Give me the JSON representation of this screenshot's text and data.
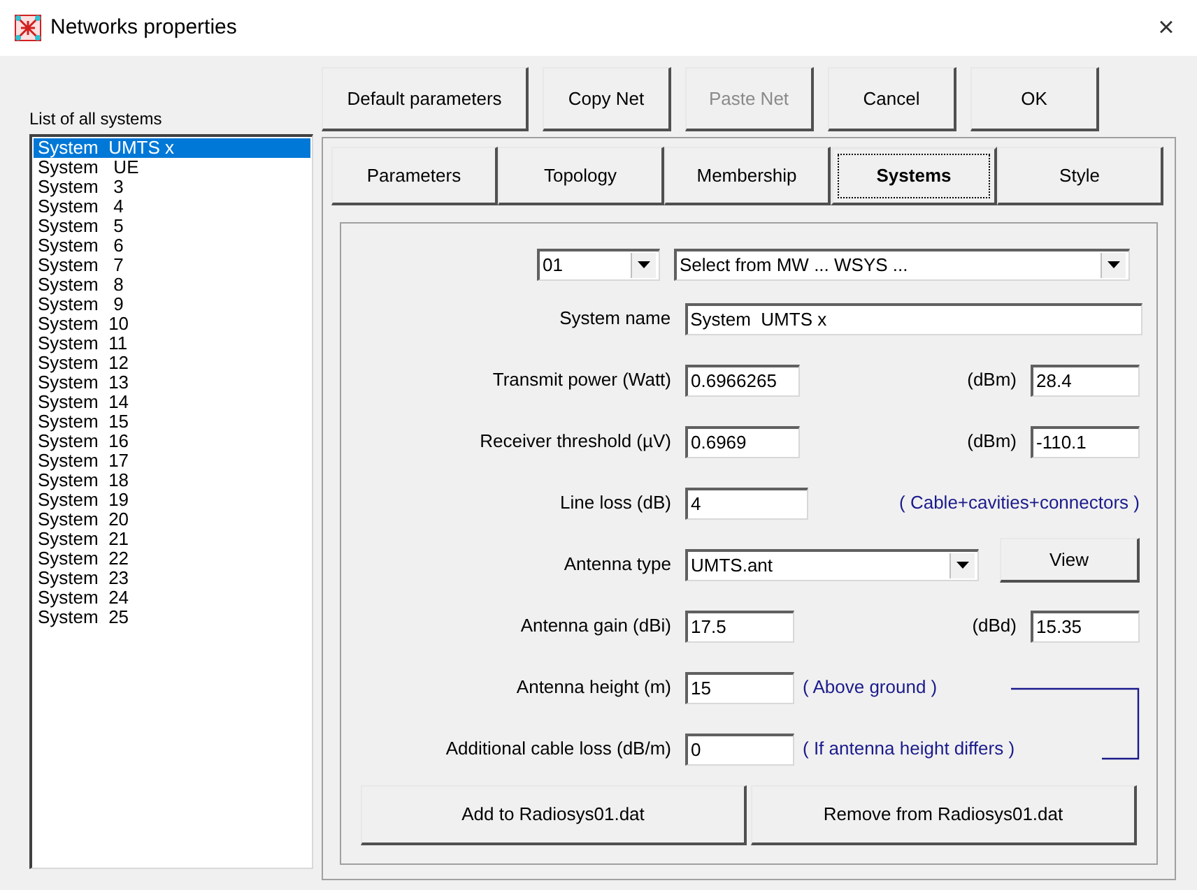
{
  "window": {
    "title": "Networks properties",
    "close": "×"
  },
  "list_label": "List of all systems",
  "systems": [
    {
      "label": "System  UMTS x",
      "selected": true
    },
    {
      "label": "System   UE",
      "selected": false
    },
    {
      "label": "System   3",
      "selected": false
    },
    {
      "label": "System   4",
      "selected": false
    },
    {
      "label": "System   5",
      "selected": false
    },
    {
      "label": "System   6",
      "selected": false
    },
    {
      "label": "System   7",
      "selected": false
    },
    {
      "label": "System   8",
      "selected": false
    },
    {
      "label": "System   9",
      "selected": false
    },
    {
      "label": "System  10",
      "selected": false
    },
    {
      "label": "System  11",
      "selected": false
    },
    {
      "label": "System  12",
      "selected": false
    },
    {
      "label": "System  13",
      "selected": false
    },
    {
      "label": "System  14",
      "selected": false
    },
    {
      "label": "System  15",
      "selected": false
    },
    {
      "label": "System  16",
      "selected": false
    },
    {
      "label": "System  17",
      "selected": false
    },
    {
      "label": "System  18",
      "selected": false
    },
    {
      "label": "System  19",
      "selected": false
    },
    {
      "label": "System  20",
      "selected": false
    },
    {
      "label": "System  21",
      "selected": false
    },
    {
      "label": "System  22",
      "selected": false
    },
    {
      "label": "System  23",
      "selected": false
    },
    {
      "label": "System  24",
      "selected": false
    },
    {
      "label": "System  25",
      "selected": false
    }
  ],
  "buttons": [
    {
      "label": "Default parameters",
      "disabled": false
    },
    {
      "label": "Copy Net",
      "disabled": false
    },
    {
      "label": "Paste Net",
      "disabled": true
    },
    {
      "label": "Cancel",
      "disabled": false
    },
    {
      "label": "OK",
      "disabled": false
    }
  ],
  "tabs": [
    {
      "label": "Parameters",
      "selected": false
    },
    {
      "label": "Topology",
      "selected": false
    },
    {
      "label": "Membership",
      "selected": false
    },
    {
      "label": "Systems",
      "selected": true
    },
    {
      "label": "Style",
      "selected": false
    }
  ],
  "selectors": {
    "index": "01",
    "source": "Select from MW ... WSYS ..."
  },
  "rows": [
    {
      "kind": "name",
      "label": "System name",
      "value": "System  UMTS x"
    },
    {
      "kind": "pair",
      "label": "Transmit power (Watt)",
      "value": "0.6966265",
      "unit": "(dBm)",
      "unit_value": "28.4"
    },
    {
      "kind": "pair",
      "label": "Receiver threshold (µV)",
      "value": "0.6969",
      "unit": "(dBm)",
      "unit_value": "-110.1"
    },
    {
      "kind": "note",
      "label": "Line loss (dB)",
      "value": "4",
      "note": "( Cable+cavities+connectors )"
    },
    {
      "kind": "select",
      "label": "Antenna type",
      "value": "UMTS.ant",
      "button": "View"
    },
    {
      "kind": "pair",
      "label": "Antenna gain (dBi)",
      "value": "17.5",
      "unit": "(dBd)",
      "unit_value": "15.35"
    },
    {
      "kind": "short_note",
      "label": "Antenna height (m)",
      "value": "15",
      "note": "( Above ground )"
    },
    {
      "kind": "short_note",
      "label": "Additional cable loss (dB/m)",
      "value": "0",
      "note": "( If antenna height differs )"
    }
  ],
  "actions": [
    "Add to Radiosys01.dat",
    "Remove from Radiosys01.dat"
  ]
}
